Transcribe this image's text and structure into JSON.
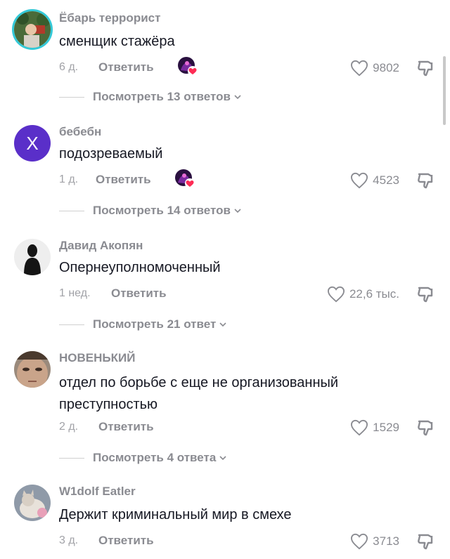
{
  "comments": [
    {
      "author": "Ёбарь террорист",
      "text": "сменщик стажёра",
      "date": "6 д.",
      "reply_label": "Ответить",
      "likes": "9802",
      "view_replies": "Посмотреть 13 ответов"
    },
    {
      "author": "бебебн",
      "avatar_letter": "X",
      "text": "подозреваемый",
      "date": "1 д.",
      "reply_label": "Ответить",
      "likes": "4523",
      "view_replies": "Посмотреть 14 ответов"
    },
    {
      "author": "Давид Акопян",
      "text": "Опернеуполномоченный",
      "date": "1 нед.",
      "reply_label": "Ответить",
      "likes": "22,6 тыс.",
      "view_replies": "Посмотреть 21 ответ"
    },
    {
      "author": "НОВЕНЬКИЙ",
      "text": "отдел по борьбе с еще не организованный преступностью",
      "date": "2 д.",
      "reply_label": "Ответить",
      "likes": "1529",
      "view_replies": "Посмотреть 4 ответа"
    },
    {
      "author": "W1dolf Eatler",
      "text": "Держит криминальный мир в смехе",
      "date": "3 д.",
      "reply_label": "Ответить",
      "likes": "3713"
    }
  ],
  "icons": {
    "like": "heart-outline-icon",
    "dislike": "thumbs-down-icon",
    "chevron": "chevron-down-icon",
    "creator_liked": "creator-liked-badge"
  },
  "colors": {
    "primary_text": "#161823",
    "secondary_text": "#8a8b91",
    "avatar_purple": "#5a2fc9",
    "story_ring": "#33c9d8",
    "liked_heart": "#fe2c55"
  }
}
